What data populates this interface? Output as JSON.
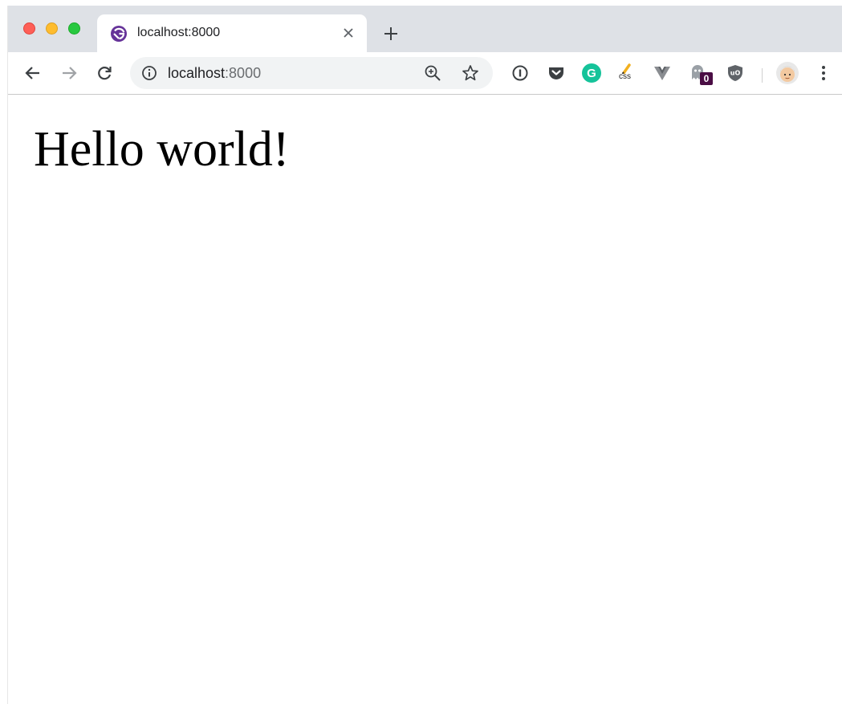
{
  "browser": {
    "tab": {
      "title": "localhost:8000",
      "favicon": "gatsby-logo-icon"
    },
    "omnibox": {
      "host": "localhost",
      "port": ":8000"
    },
    "extensions": [
      "1password-icon",
      "pocket-icon",
      "grammarly-icon",
      "css-peeper-icon",
      "vue-devtools-icon",
      "ghostery-icon",
      "ublock-icon"
    ],
    "ghostery_badge": "0",
    "css_ext_label": "css",
    "grammarly_letter": "G"
  },
  "page": {
    "headline": "Hello world!"
  },
  "colors": {
    "tabstrip": "#dee1e6",
    "omnibox": "#f1f3f4",
    "gatsby_purple": "#663399",
    "grammarly_green": "#15c39a",
    "ghostery_badge_bg": "#4a0d44"
  }
}
